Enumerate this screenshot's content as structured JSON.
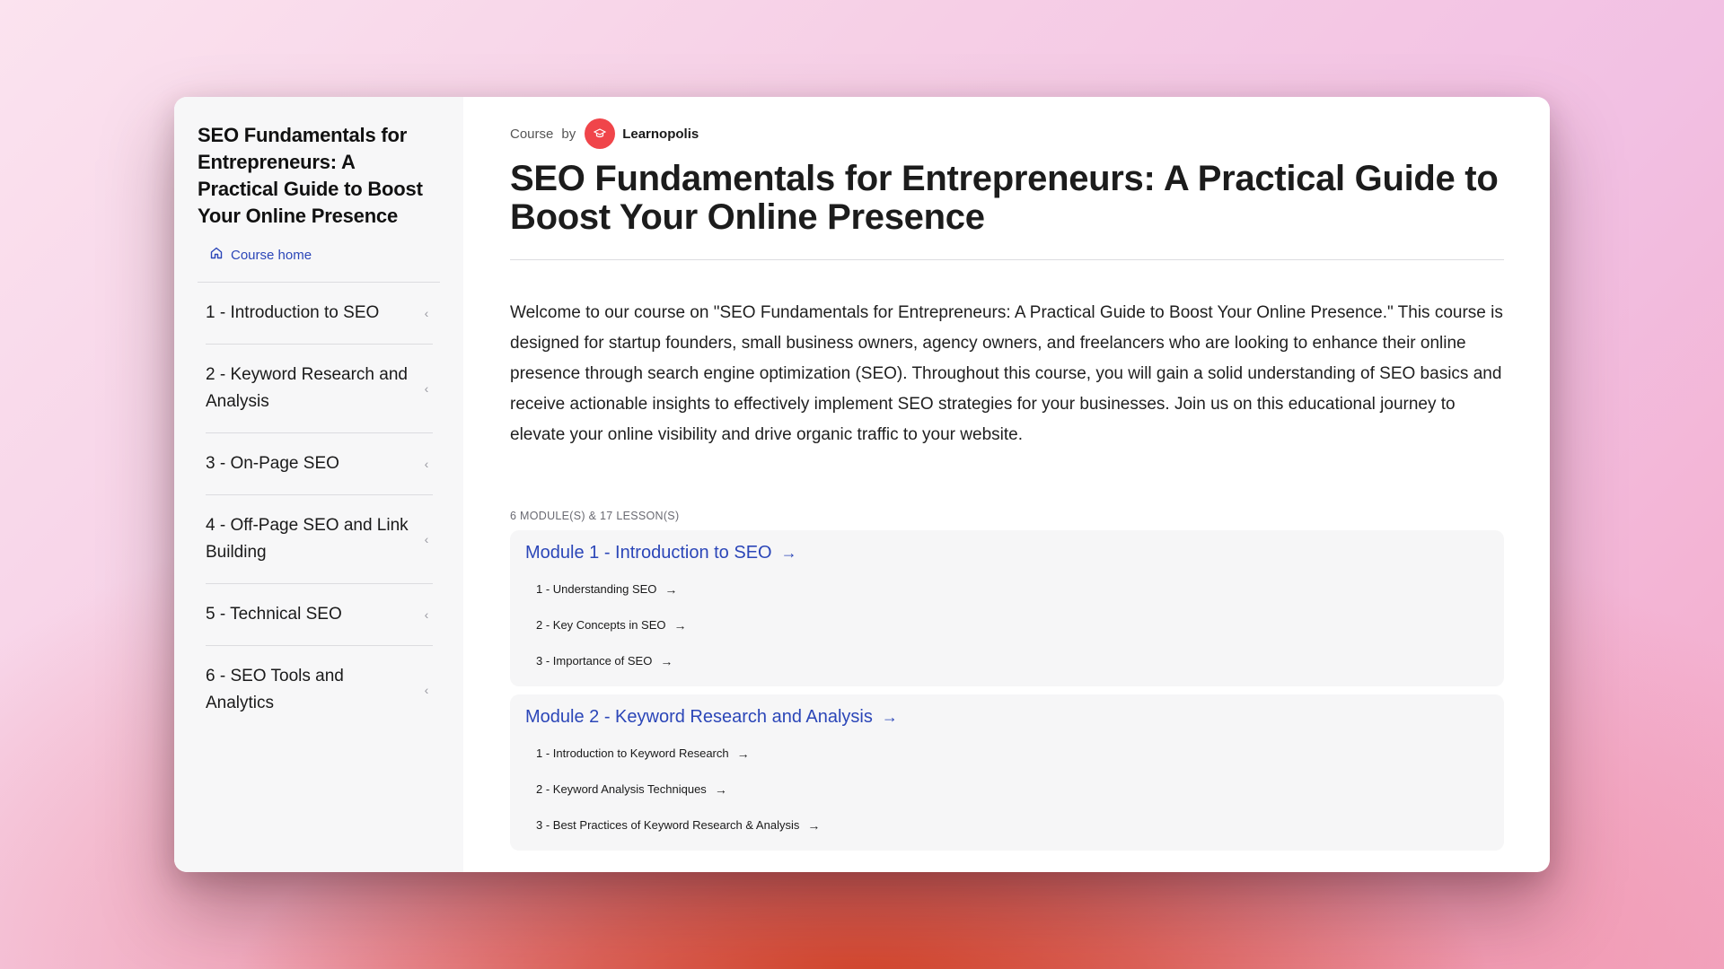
{
  "sidebar": {
    "title": "SEO Fundamentals for Entrepreneurs: A Practical Guide to Boost Your Online Presence",
    "course_home": "Course home",
    "items": [
      {
        "label": "1 - Introduction to SEO"
      },
      {
        "label": "2 - Keyword Research and Analysis"
      },
      {
        "label": "3 - On-Page SEO"
      },
      {
        "label": "4 - Off-Page SEO and Link Building"
      },
      {
        "label": "5 - Technical SEO"
      },
      {
        "label": "6 - SEO Tools and Analytics"
      }
    ]
  },
  "header": {
    "course_label": "Course",
    "by_label": "by",
    "author": "Learnopolis",
    "title": "SEO Fundamentals for Entrepreneurs: A Practical Guide to Boost Your Online Presence"
  },
  "description": "Welcome to our course on \"SEO Fundamentals for Entrepreneurs: A Practical Guide to Boost Your Online Presence.\" This course is designed for startup founders, small business owners, agency owners, and freelancers who are looking to enhance their online presence through search engine optimization (SEO). Throughout this course, you will gain a solid understanding of SEO basics and receive actionable insights to effectively implement SEO strategies for your businesses. Join us on this educational journey to elevate your online visibility and drive organic traffic to your website.",
  "counts": "6 MODULE(S) & 17 LESSON(S)",
  "modules": [
    {
      "title": "Module 1 - Introduction to SEO",
      "lessons": [
        "1 - Understanding SEO",
        "2 - Key Concepts in SEO",
        "3 - Importance of SEO"
      ]
    },
    {
      "title": "Module 2 - Keyword Research and Analysis",
      "lessons": [
        "1 - Introduction to Keyword Research",
        "2 - Keyword Analysis Techniques",
        "3 - Best Practices of Keyword Research & Analysis"
      ]
    }
  ],
  "colors": {
    "accent": "#2b46b8",
    "avatar": "#f0454a"
  },
  "icons": {
    "course_home": "home-icon",
    "sidebar_chevron": "chevron-left-icon",
    "link_arrow": "arrow-right-icon"
  }
}
